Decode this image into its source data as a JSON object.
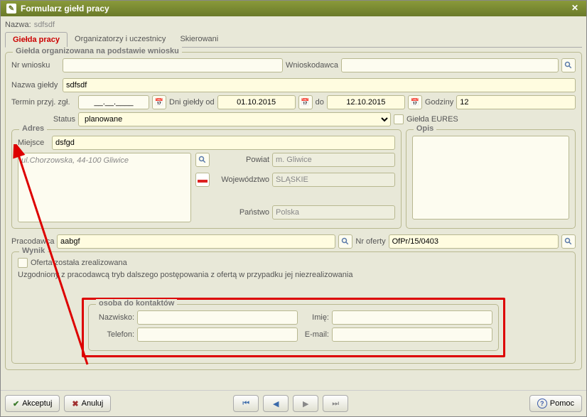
{
  "window": {
    "title": "Formularz giełd pracy"
  },
  "header": {
    "nazwa_label": "Nazwa:",
    "nazwa_value": "sdfsdf"
  },
  "tabs": [
    {
      "label": "Giełda pracy",
      "active": true
    },
    {
      "label": "Organizatorzy i uczestnicy",
      "active": false
    },
    {
      "label": "Skierowani",
      "active": false
    }
  ],
  "gp": {
    "title": "Giełda organizowana na podstawie wniosku",
    "nr_wniosku_label": "Nr wniosku",
    "nr_wniosku_value": "",
    "wnioskodawca_label": "Wnioskodawca",
    "wnioskodawca_value": "",
    "nazwa_gieldy_label": "Nazwa giełdy",
    "nazwa_gieldy_value": "sdfsdf",
    "termin_label": "Termin przyj. zgł.",
    "termin_value": "__.__.____",
    "dni_od_label": "Dni giełdy od",
    "dni_od_value": "01.10.2015",
    "do_label": "do",
    "do_value": "12.10.2015",
    "godziny_label": "Godziny",
    "godziny_value": "12",
    "status_label": "Status",
    "status_value": "planowane",
    "eures_label": "Giełda EURES"
  },
  "adres": {
    "title": "Adres",
    "miejsce_label": "Miejsce",
    "miejsce_value": "dsfgd",
    "address_text": "ul.Chorzowska, 44-100 Gliwice",
    "powiat_label": "Powiat",
    "powiat_value": "m. Gliwice",
    "woj_label": "Województwo",
    "woj_value": "ŚLĄSKIE",
    "panstwo_label": "Państwo",
    "panstwo_value": "Polska"
  },
  "opis": {
    "title": "Opis",
    "value": ""
  },
  "offer": {
    "pracodawca_label": "Pracodawca",
    "pracodawca_value": "aabgf",
    "nr_oferty_label": "Nr oferty",
    "nr_oferty_value": "OfPr/15/0403"
  },
  "wynik": {
    "title": "Wynik",
    "realized_label": "Oferta została zrealizowana",
    "tryb_label": "Uzgodniony z pracodawcą tryb dalszego postępowania z ofertą w przypadku jej niezrealizowania",
    "tryb_value": ""
  },
  "kontakt": {
    "title": "osoba do kontaktów",
    "nazwisko_label": "Nazwisko:",
    "nazwisko_value": "",
    "imie_label": "Imię:",
    "imie_value": "",
    "telefon_label": "Telefon:",
    "telefon_value": "",
    "email_label": "E-mail:",
    "email_value": ""
  },
  "footer": {
    "akceptuj": "Akceptuj",
    "anuluj": "Anuluj",
    "pomoc": "Pomoc"
  }
}
